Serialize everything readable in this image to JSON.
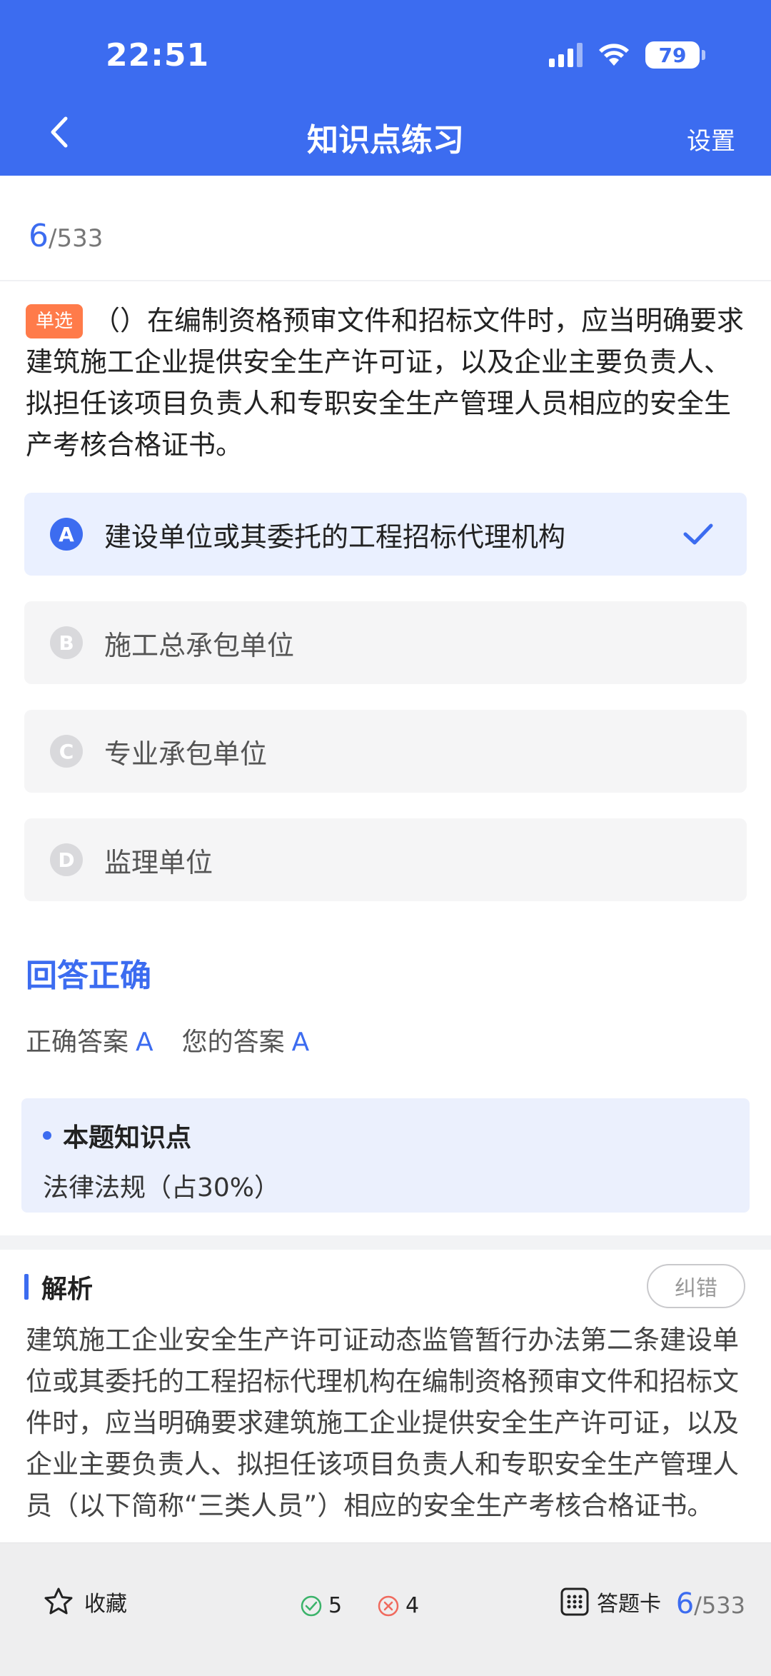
{
  "status": {
    "time": "22:51",
    "battery": "79"
  },
  "nav": {
    "title": "知识点练习",
    "settings": "设置"
  },
  "progress": {
    "current": "6",
    "total": "/533"
  },
  "question": {
    "type": "单选",
    "text": "（）在编制资格预审文件和招标文件时，应当明确要求建筑施工企业提供安全生产许可证，以及企业主要负责人、拟担任该项目负责人和专职安全生产管理人员相应的安全生产考核合格证书。"
  },
  "options": [
    {
      "letter": "A",
      "text": "建设单位或其委托的工程招标代理机构",
      "selected": true
    },
    {
      "letter": "B",
      "text": "施工总承包单位",
      "selected": false
    },
    {
      "letter": "C",
      "text": "专业承包单位",
      "selected": false
    },
    {
      "letter": "D",
      "text": "监理单位",
      "selected": false
    }
  ],
  "result": {
    "title": "回答正确",
    "correct_label": "正确答案",
    "correct_value": "A",
    "your_label": "您的答案",
    "your_value": "A"
  },
  "knowledge": {
    "title": "本题知识点",
    "text": "法律法规（占30%）"
  },
  "analysis": {
    "title": "解析",
    "report": "纠错",
    "text": "建筑施工企业安全生产许可证动态监管暂行办法第二条建设单位或其委托的工程招标代理机构在编制资格预审文件和招标文件时，应当明确要求建筑施工企业提供安全生产许可证，以及企业主要负责人、拟担任该项目负责人和专职安全生产管理人员（以下简称“三类人员”）相应的安全生产考核合格证书。"
  },
  "bottom": {
    "favorite": "收藏",
    "correct_count": "5",
    "wrong_count": "4",
    "answer_card": "答题卡",
    "current": "6",
    "total": "/533"
  },
  "colors": {
    "accent": "#3c6cf0",
    "tag": "#ff7b4a",
    "ok": "#3bb36a",
    "err": "#f06a5e"
  },
  "icons": [
    "back-icon",
    "signal-icon",
    "wifi-icon",
    "battery-icon",
    "check-icon",
    "star-icon",
    "correct-circle-icon",
    "wrong-circle-icon",
    "grid-icon"
  ]
}
